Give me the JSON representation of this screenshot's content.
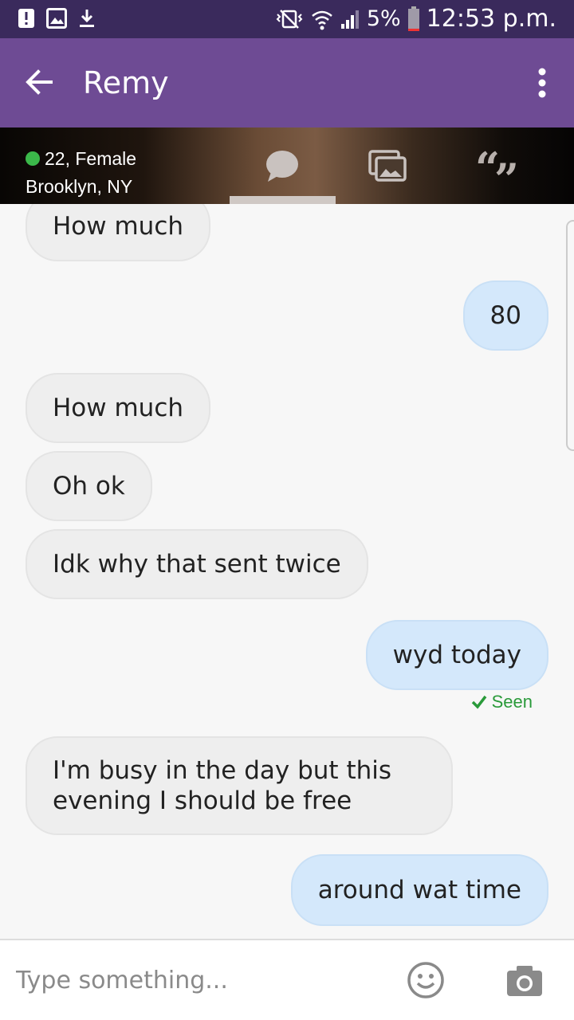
{
  "status_bar": {
    "battery_percent": "5%",
    "time": "12:53 p.m.",
    "icons": [
      "alert-icon",
      "image-icon",
      "download-icon",
      "vibrate-silent-icon",
      "wifi-icon",
      "signal-icon",
      "battery-icon"
    ]
  },
  "app_bar": {
    "title": "Remy",
    "icons": [
      "back-arrow-icon",
      "overflow-menu-icon"
    ]
  },
  "profile": {
    "age_gender": "22, Female",
    "location": "Brooklyn, NY",
    "status_color": "#3bb84a",
    "tabs": [
      "chat-bubble-icon",
      "photos-icon",
      "quote-icon"
    ],
    "active_tab_index": 0
  },
  "messages": [
    {
      "side": "received",
      "text": "How much"
    },
    {
      "side": "sent",
      "text": "80"
    },
    {
      "side": "received",
      "text": "How much"
    },
    {
      "side": "received",
      "text": "Oh ok"
    },
    {
      "side": "received",
      "text": "Idk why that sent twice"
    },
    {
      "side": "sent",
      "text": "wyd today",
      "receipt": "Seen"
    },
    {
      "side": "received",
      "text": "I'm busy in the day but this evening I should be free"
    },
    {
      "side": "sent",
      "text": "around wat time"
    }
  ],
  "input": {
    "placeholder": "Type something...",
    "value": ""
  },
  "colors": {
    "status_bar": "#3a2a5c",
    "app_bar": "#6e4b94",
    "received_bubble": "#eeeeee",
    "sent_bubble": "#d4e8fb",
    "seen": "#2a9a3a"
  }
}
